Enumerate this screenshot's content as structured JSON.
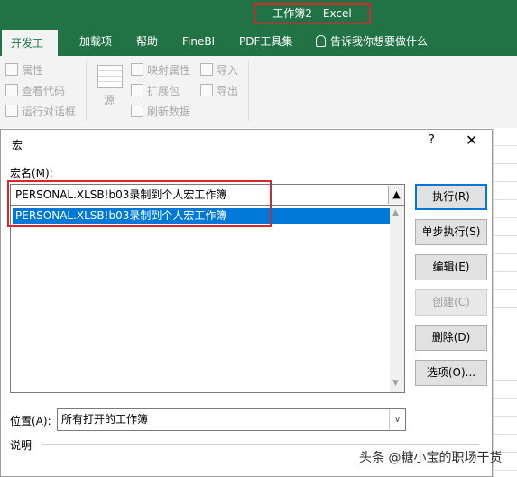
{
  "window": {
    "title": "工作簿2  -  Excel"
  },
  "tabs": [
    "开发工具",
    "加载项",
    "帮助",
    "FineBI",
    "PDF工具集",
    "告诉我你想要做什么"
  ],
  "ribbon": {
    "properties": "属性",
    "view_code": "查看代码",
    "run_dialog": "运行对话框",
    "source": "源",
    "map_properties": "映射属性",
    "expansion_pack": "扩展包",
    "refresh_data": "刷新数据",
    "import": "导入",
    "export": "导出"
  },
  "dialog": {
    "title": "宏",
    "help": "?",
    "close": "✕",
    "macro_name_label": "宏名(M):",
    "macro_name_value": "PERSONAL.XLSB!b03录制到个人宏工作簿",
    "list_items": [
      "PERSONAL.XLSB!b03录制到个人宏工作簿"
    ],
    "buttons": {
      "run": "执行(R)",
      "step_into": "单步执行(S)",
      "edit": "编辑(E)",
      "create": "创建(C)",
      "delete": "删除(D)",
      "options": "选项(O)..."
    },
    "location_label": "位置(A):",
    "location_value": "所有打开的工作簿",
    "description_label": "说明"
  },
  "watermark": "头条 @糖小宝的职场干货"
}
